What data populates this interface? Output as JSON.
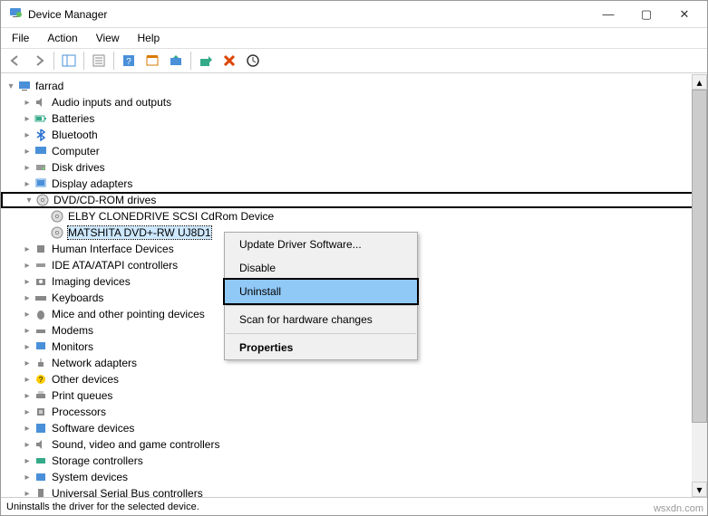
{
  "window": {
    "title": "Device Manager"
  },
  "menubar": {
    "file": "File",
    "action": "Action",
    "view": "View",
    "help": "Help"
  },
  "tree": {
    "root": "farrad",
    "nodes": {
      "audio": "Audio inputs and outputs",
      "batteries": "Batteries",
      "bluetooth": "Bluetooth",
      "computer": "Computer",
      "disk": "Disk drives",
      "display": "Display adapters",
      "dvd": "DVD/CD-ROM drives",
      "dvd_child1": "ELBY CLONEDRIVE SCSI CdRom Device",
      "dvd_child2": "MATSHITA DVD+-RW UJ8D1",
      "hid": "Human Interface Devices",
      "ide": "IDE ATA/ATAPI controllers",
      "imaging": "Imaging devices",
      "keyboards": "Keyboards",
      "mice": "Mice and other pointing devices",
      "modems": "Modems",
      "monitors": "Monitors",
      "network": "Network adapters",
      "other": "Other devices",
      "print": "Print queues",
      "processors": "Processors",
      "software": "Software devices",
      "sound": "Sound, video and game controllers",
      "storage": "Storage controllers",
      "system": "System devices",
      "usb": "Universal Serial Bus controllers"
    }
  },
  "context_menu": {
    "update": "Update Driver Software...",
    "disable": "Disable",
    "uninstall": "Uninstall",
    "scan": "Scan for hardware changes",
    "properties": "Properties"
  },
  "statusbar": {
    "text": "Uninstalls the driver for the selected device."
  },
  "watermark": "wsxdn.com"
}
